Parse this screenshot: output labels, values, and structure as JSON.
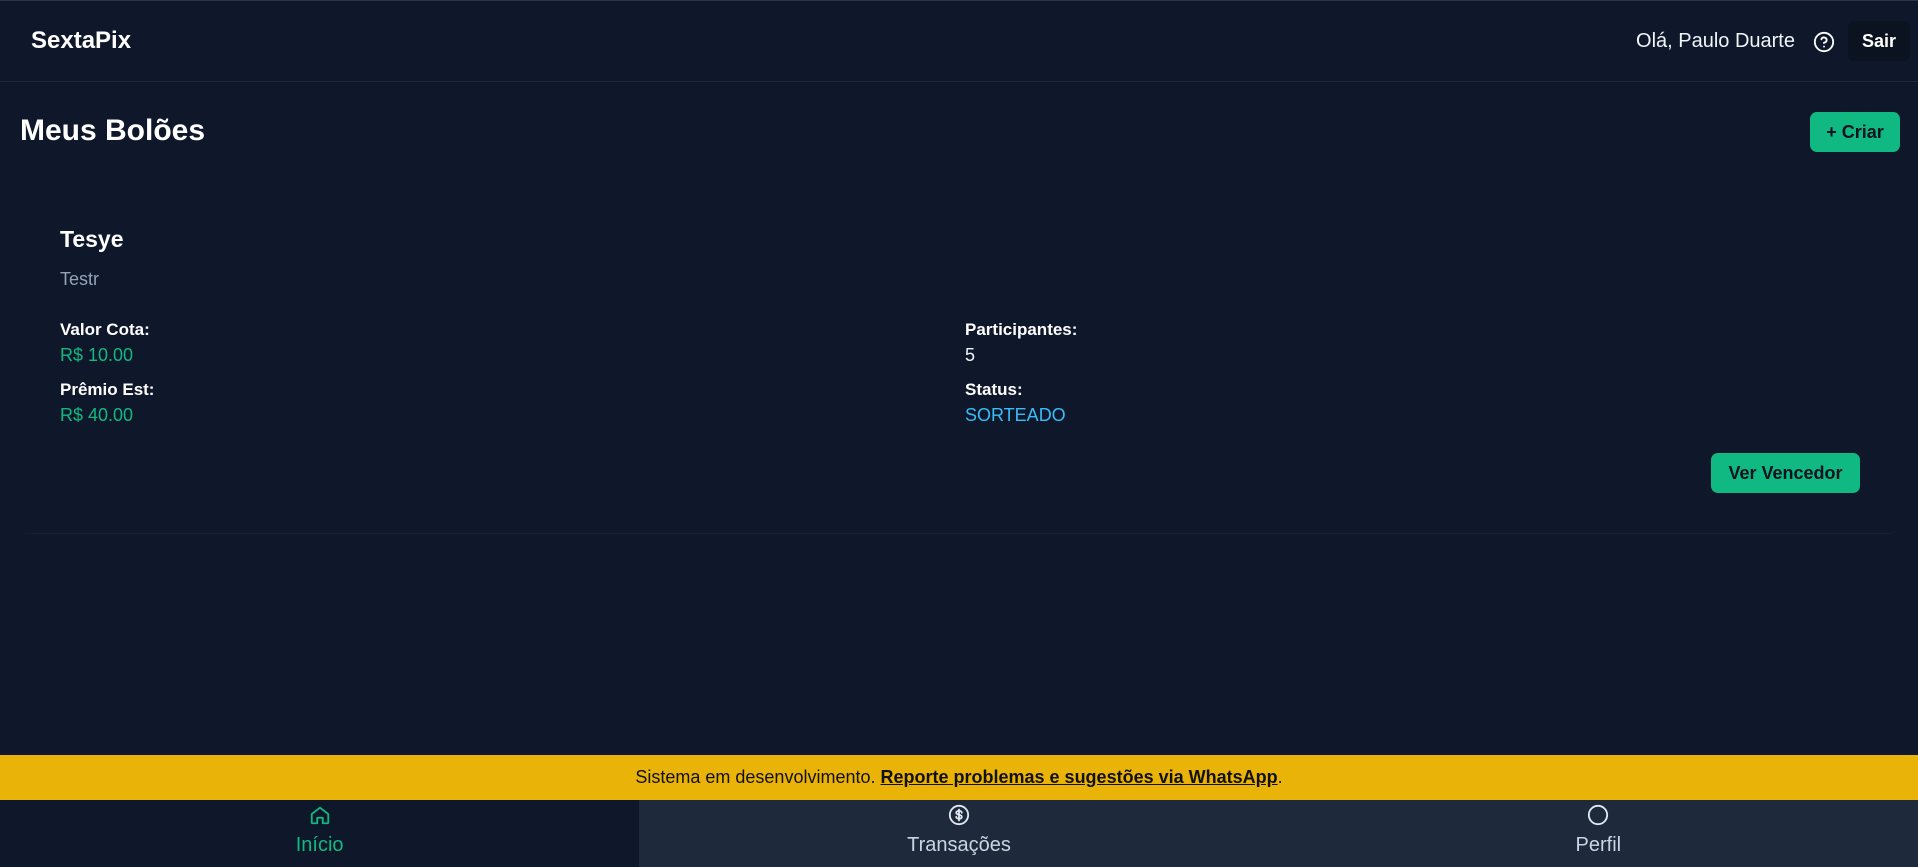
{
  "header": {
    "brand": "SextaPix",
    "greeting": "Olá, Paulo Duarte",
    "help_icon": "help-circle-icon",
    "logout_label": "Sair"
  },
  "main": {
    "title": "Meus Bolões",
    "create_label": "+ Criar"
  },
  "pool": {
    "name": "Tesye",
    "description": "Testr",
    "quota_label": "Valor Cota:",
    "quota_value": "R$ 10.00",
    "prize_label": "Prêmio Est:",
    "prize_value": "R$ 40.00",
    "participants_label": "Participantes:",
    "participants_value": "5",
    "status_label": "Status:",
    "status_value": "SORTEADO",
    "winner_button": "Ver Vencedor"
  },
  "banner": {
    "text": "Sistema em desenvolvimento.",
    "link": "Reporte problemas e sugestões via WhatsApp",
    "suffix": "."
  },
  "nav": {
    "items": [
      {
        "label": "Início",
        "icon": "home-icon",
        "active": true
      },
      {
        "label": "Transações",
        "icon": "dollar-circle-icon",
        "active": false
      },
      {
        "label": "Perfil",
        "icon": "user-circle-icon",
        "active": false
      }
    ]
  },
  "colors": {
    "background": "#0f172a",
    "accent": "#10b981",
    "status": "#38bdf8",
    "banner": "#eab308",
    "nav_inactive": "#1e293b"
  }
}
